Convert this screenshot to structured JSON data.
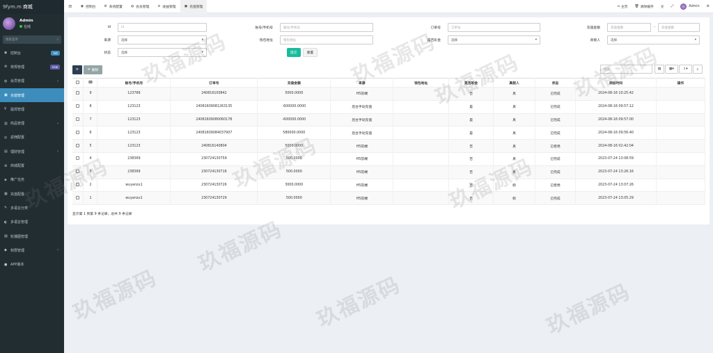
{
  "brand": {
    "watermark": "9fym.m",
    "title": "商城"
  },
  "user": {
    "name": "Admin",
    "status": "在线"
  },
  "sidebar": {
    "search_placeholder": "搜索菜单",
    "items": [
      {
        "label": "控制台",
        "icon": "dashboard-icon",
        "badge": "hot",
        "badge_color": "#3c8dbc"
      },
      {
        "label": "常规管理",
        "icon": "cog-icon",
        "badge": "new",
        "badge_color": "#605ca8"
      },
      {
        "label": "会员管理",
        "icon": "user-icon",
        "arrow": "‹"
      },
      {
        "label": "充值管理",
        "icon": "recharge-icon",
        "active": true
      },
      {
        "label": "提现管理",
        "icon": "withdraw-icon"
      },
      {
        "label": "商品管理",
        "icon": "goods-icon",
        "arrow": "‹"
      },
      {
        "label": "返佣配置",
        "icon": "rebate-icon"
      },
      {
        "label": "理财管理",
        "icon": "finance-icon",
        "arrow": "‹"
      },
      {
        "label": "商城配置",
        "icon": "mall-icon"
      },
      {
        "label": "推广任务",
        "icon": "promo-icon"
      },
      {
        "label": "充值配置",
        "icon": "recharge-config-icon"
      },
      {
        "label": "多语言分类",
        "icon": "lang-category-icon"
      },
      {
        "label": "多语言管理",
        "icon": "lang-icon"
      },
      {
        "label": "轮播图管理",
        "icon": "banner-icon"
      },
      {
        "label": "权限管理",
        "icon": "auth-icon",
        "arrow": "‹"
      },
      {
        "label": "APP版本",
        "icon": "app-icon"
      }
    ]
  },
  "topbar": {
    "tabs": [
      {
        "label": "控制台",
        "icon": "dashboard-icon"
      },
      {
        "label": "系统配置",
        "icon": "cog-icon"
      },
      {
        "label": "会员管理",
        "icon": "user-icon"
      },
      {
        "label": "收益管理",
        "icon": "income-icon"
      },
      {
        "label": "充值管理",
        "icon": "recharge-icon",
        "active": true
      }
    ],
    "right": {
      "home": "主页",
      "clear": "清除缓存",
      "admin": "Admin"
    }
  },
  "filters": {
    "id_label": "id",
    "id_ph": "id",
    "account_label": "账号/手机号",
    "account_ph": "账号/手机号",
    "order_label": "订单号",
    "order_ph": "订单号",
    "amount_label": "充值金额",
    "amount_min_ph": "充值金额",
    "amount_sep": "-",
    "amount_max_ph": "充值金额",
    "source_label": "来源",
    "source_value": "选择",
    "wallet_label": "钱包地址",
    "wallet_ph": "钱包地址",
    "bonus_label": "是否彩金",
    "bonus_value": "选择",
    "auditor_label": "真假人",
    "auditor_value": "选择",
    "status_label": "状态",
    "status_value": "选择",
    "submit": "提交",
    "reset": "重置"
  },
  "toolbar": {
    "refresh": "⟳",
    "delete": "删除",
    "search_ph": "搜索"
  },
  "table": {
    "columns": [
      "",
      "ID",
      "账号/手机号",
      "订单号",
      "充值金额",
      "来源",
      "钱包地址",
      "是否彩金",
      "真假人",
      "状态",
      "添加时间",
      "操作"
    ],
    "rows": [
      [
        "9",
        "123789",
        "240816100842",
        "5000.0000",
        "H5前端",
        "",
        "否",
        "真",
        "已完成",
        "2024-08-16 10:25:42"
      ],
      [
        "8",
        "123123",
        "240816090812631​35",
        "-600000.0000",
        "后台手动充值",
        "",
        "是",
        "真",
        "已完成",
        "2024-08-16 09:57:12"
      ],
      [
        "7",
        "123123",
        "240816090800601​78",
        "-600000.0000",
        "后台手动充值",
        "",
        "是",
        "真",
        "已完成",
        "2024-08-16 09:57:00"
      ],
      [
        "6",
        "123123",
        "240816090840379​07",
        "580000.0000",
        "后台手动充值",
        "",
        "是",
        "真",
        "已完成",
        "2024-08-16 09:56:40"
      ],
      [
        "5",
        "123123",
        "240816140804",
        "5000.0000",
        "H5前端",
        "",
        "否",
        "真",
        "已拒绝",
        "2024-08-16 02:42:04"
      ],
      [
        "4",
        "238369",
        "230724130759",
        "500.0000",
        "H5前端",
        "",
        "否",
        "真",
        "已完成",
        "2023-07-24 13:08:59"
      ],
      [
        "3",
        "238369",
        "230724130716",
        "500.0000",
        "H5前端",
        "",
        "否",
        "真",
        "已完成",
        "2023-07-24 13:26:16"
      ],
      [
        "2",
        "wuyanzu1",
        "230724130726",
        "3000.0000",
        "H5前端",
        "",
        "否",
        "假",
        "已拒绝",
        "2023-07-24 13:07:26"
      ],
      [
        "1",
        "wuyanzu1",
        "230724130729",
        "500.0000",
        "H5前端",
        "",
        "否",
        "假",
        "已完成",
        "2023-07-24 13:05:29"
      ]
    ]
  },
  "footer": {
    "summary": "显示第 1 到第 9 条记录，总共 9 条记录"
  },
  "watermark_text": "玖福源码",
  "colors": {
    "accent": "#3c8dbc",
    "sidebar": "#222d32",
    "submit": "#18bc9c"
  }
}
